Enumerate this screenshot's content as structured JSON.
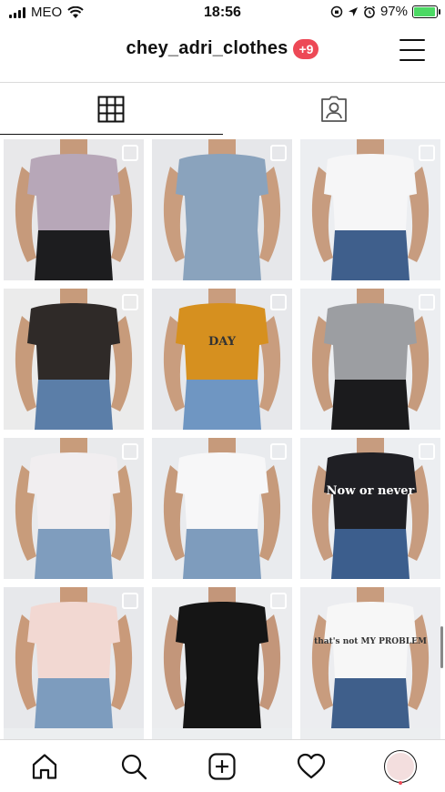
{
  "status_bar": {
    "carrier": "MEO",
    "time": "18:56",
    "battery": "97%",
    "battery_level": 0.97,
    "icons": [
      "signal-icon",
      "wifi-icon",
      "orientation-lock-icon",
      "location-icon",
      "alarm-icon",
      "battery-icon"
    ]
  },
  "header": {
    "username": "chey_adri_clothes",
    "badge": "+9",
    "menu_icon": "hamburger-menu-icon"
  },
  "tabs": [
    {
      "name": "grid",
      "icon": "grid-icon",
      "active": true
    },
    {
      "name": "tagged",
      "icon": "tagged-person-icon",
      "active": false
    }
  ],
  "grid": {
    "posts": [
      {
        "id": "post-1",
        "multi": true,
        "bg": "#e8e8ea",
        "garment": "#b7a7b8",
        "bottom": "#1d1d1f",
        "skin": "#c69a7b",
        "text": ""
      },
      {
        "id": "post-2",
        "multi": true,
        "bg": "#e6e7ea",
        "garment": "#8aa3bd",
        "bottom": "#8aa3bd",
        "skin": "#c99d7e",
        "text": ""
      },
      {
        "id": "post-3",
        "multi": true,
        "bg": "#eceef1",
        "garment": "#f6f6f7",
        "bottom": "#3f5f8c",
        "skin": "#c79c7f",
        "text": ""
      },
      {
        "id": "post-4",
        "multi": true,
        "bg": "#ebebeb",
        "garment": "#2f2a28",
        "bottom": "#5b7ea8",
        "skin": "#c79b7b",
        "text": ""
      },
      {
        "id": "post-5",
        "multi": true,
        "bg": "#e7e8eb",
        "garment": "#d6901f",
        "bottom": "#6f96c2",
        "skin": "#c99d7e",
        "text": "DAY"
      },
      {
        "id": "post-6",
        "multi": true,
        "bg": "#eceef1",
        "garment": "#9c9ea2",
        "bottom": "#1b1b1d",
        "skin": "#c69b7d",
        "text": ""
      },
      {
        "id": "post-7",
        "multi": true,
        "bg": "#e9eaec",
        "garment": "#f1eef0",
        "bottom": "#7f9dbe",
        "skin": "#c89c7b",
        "text": ""
      },
      {
        "id": "post-8",
        "multi": true,
        "bg": "#e9ebee",
        "garment": "#f7f7f8",
        "bottom": "#7e9cbd",
        "skin": "#c69a7b",
        "text": ""
      },
      {
        "id": "post-9",
        "multi": true,
        "bg": "#eceef1",
        "garment": "#1f1f24",
        "bottom": "#3c5e8d",
        "skin": "#c79c7f",
        "text": "Now or never"
      },
      {
        "id": "post-10",
        "multi": true,
        "bg": "#e7e8eb",
        "garment": "#f2d8d2",
        "bottom": "#7d9cbe",
        "skin": "#c99a7a",
        "text": ""
      },
      {
        "id": "post-11",
        "multi": true,
        "bg": "#ebecee",
        "garment": "#151515",
        "bottom": "#151515",
        "skin": "#c3967a",
        "text": ""
      },
      {
        "id": "post-12",
        "multi": false,
        "bg": "#ecedf0",
        "garment": "#f7f7f7",
        "bottom": "#3f5f8b",
        "skin": "#c89c7e",
        "text": "that's not MY PROBLEM"
      }
    ]
  },
  "bottom_nav": [
    {
      "name": "home",
      "icon": "home-icon"
    },
    {
      "name": "search",
      "icon": "search-icon"
    },
    {
      "name": "new-post",
      "icon": "add-post-icon"
    },
    {
      "name": "activity",
      "icon": "heart-icon"
    },
    {
      "name": "profile",
      "icon": "profile-avatar-icon"
    }
  ]
}
